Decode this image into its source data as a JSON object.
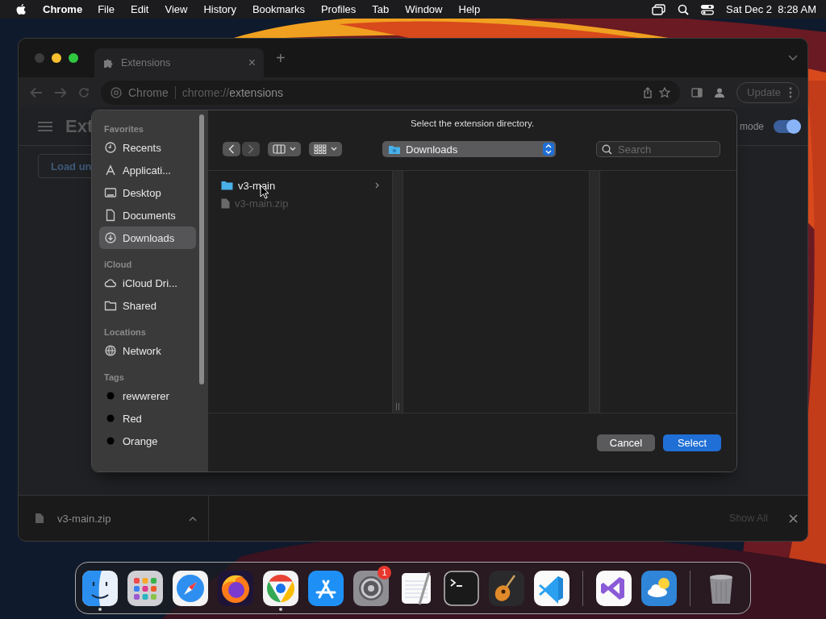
{
  "menu_bar": {
    "app_name": "Chrome",
    "menus": [
      "File",
      "Edit",
      "View",
      "History",
      "Bookmarks",
      "Profiles",
      "Tab",
      "Window",
      "Help"
    ],
    "clock": "Sat Dec 2  8:28 AM"
  },
  "browser": {
    "tab": {
      "title": "Extensions",
      "close": "×"
    },
    "new_tab": "+",
    "address": {
      "site": "Chrome",
      "url_prefix": "chrome://",
      "url_path": "extensions"
    },
    "update_button": "Update",
    "page": {
      "title": "Ext",
      "load_button": "Load un",
      "toggle_label": "mode",
      "developer_mode_on": true
    }
  },
  "dialog": {
    "message": "Select the extension directory.",
    "location": "Downloads",
    "search": {
      "placeholder": "Search"
    },
    "sidebar": [
      {
        "heading": "Favorites",
        "items": [
          {
            "label": "Recents",
            "kind": "clock",
            "selected": false
          },
          {
            "label": "Applicati...",
            "kind": "apps",
            "selected": false
          },
          {
            "label": "Desktop",
            "kind": "desktop",
            "selected": false
          },
          {
            "label": "Documents",
            "kind": "document",
            "selected": false
          },
          {
            "label": "Downloads",
            "kind": "download",
            "selected": true
          }
        ]
      },
      {
        "heading": "iCloud",
        "items": [
          {
            "label": "iCloud Dri...",
            "kind": "cloud",
            "selected": false
          },
          {
            "label": "Shared",
            "kind": "shared",
            "selected": false
          }
        ]
      },
      {
        "heading": "Locations",
        "items": [
          {
            "label": "Network",
            "kind": "globe",
            "selected": false
          }
        ]
      },
      {
        "heading": "Tags",
        "items": [
          {
            "label": "rewwrerer",
            "kind": "tag",
            "selected": false
          },
          {
            "label": "Red",
            "kind": "tag",
            "selected": false
          },
          {
            "label": "Orange",
            "kind": "tag",
            "selected": false
          }
        ]
      }
    ],
    "files": [
      {
        "name": "v3-main",
        "kind": "folder",
        "disabled": false
      },
      {
        "name": "v3-main.zip",
        "kind": "file",
        "disabled": true
      }
    ],
    "cancel_button": "Cancel",
    "select_button": "Select"
  },
  "download_bar": {
    "file": "v3-main.zip",
    "show_all": "Show All"
  },
  "dock": {
    "sections": [
      {
        "apps": [
          {
            "kind": "finder",
            "running": true
          },
          {
            "kind": "launchpad",
            "running": false
          },
          {
            "kind": "safari",
            "running": false
          },
          {
            "kind": "firefox",
            "running": false
          },
          {
            "kind": "chrome",
            "running": true
          },
          {
            "kind": "appstore",
            "running": false
          },
          {
            "kind": "settings",
            "running": false,
            "badge": "1"
          },
          {
            "kind": "textedit",
            "running": false
          },
          {
            "kind": "terminal",
            "running": false
          },
          {
            "kind": "guitar",
            "running": false
          },
          {
            "kind": "vscode",
            "running": false
          }
        ]
      },
      {
        "apps": [
          {
            "kind": "visualstudio",
            "running": false
          },
          {
            "kind": "weather",
            "running": false
          }
        ]
      },
      {
        "apps": [
          {
            "kind": "trash",
            "running": false
          }
        ]
      }
    ]
  }
}
